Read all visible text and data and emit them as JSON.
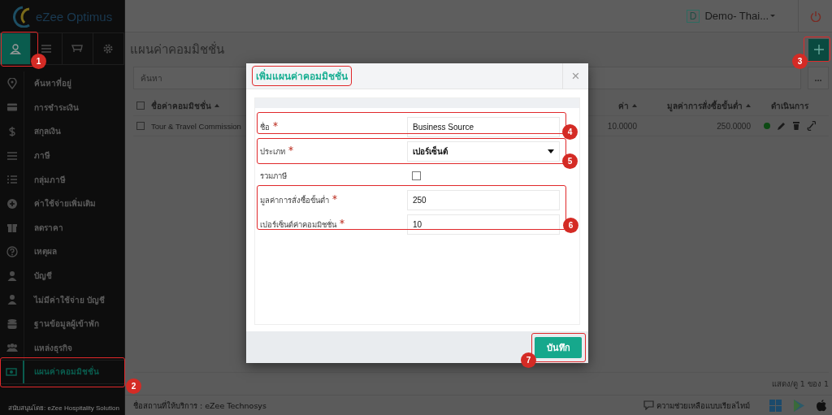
{
  "sidebar": {
    "logo": "eZee Optimus",
    "tabs": [
      {
        "selected": true
      },
      {
        "selected": false
      },
      {
        "selected": false
      },
      {
        "selected": false
      }
    ],
    "items": [
      {
        "label": "ค้นหาที่อยู่",
        "selected": false
      },
      {
        "label": "การชำระเงิน",
        "selected": false
      },
      {
        "label": "สกุลเงิน",
        "selected": false
      },
      {
        "label": "ภาษี",
        "selected": false
      },
      {
        "label": "กลุ่มภาษี",
        "selected": false
      },
      {
        "label": "ค่าใช้จ่ายเพิ่มเติม",
        "selected": false
      },
      {
        "label": "ลดราคา",
        "selected": false
      },
      {
        "label": "เหตุผล",
        "selected": false
      },
      {
        "label": "บัญชี",
        "selected": false
      },
      {
        "label": "ไม่มีค่าใช้จ่าย บัญชี",
        "selected": false
      },
      {
        "label": "ฐานข้อมูลผู้เข้าพัก",
        "selected": false
      },
      {
        "label": "แหล่งธุรกิจ",
        "selected": false
      },
      {
        "label": "แผนค่าคอมมิชชั่น",
        "selected": true
      }
    ],
    "footer": "สนับสนุนโดย: eZee Hospitality Solution"
  },
  "topbar": {
    "property_badge": "D",
    "property": "Demo- Thai..."
  },
  "page": {
    "title": "แผนค่าคอมมิชชั่น",
    "search": {
      "placeholder": "ค้นหา"
    },
    "more": "...",
    "table": {
      "all_checked": false,
      "columns": [
        {
          "label": "ชื่อค่าคอมมิชชั่น"
        },
        {
          "label": "ค่า"
        },
        {
          "label": "มูลค่าการสั่งซื้อขั้นต่ำ"
        },
        {
          "label": "ดำเนินการ"
        }
      ],
      "rows": [
        {
          "checked": false,
          "name": "Tour & Travel Commission",
          "value": "10.0000",
          "min_order": "250.0000"
        }
      ]
    },
    "pager": "แสดง/ดู 1 ของ 1"
  },
  "status_bar": {
    "provider": "ชื่อสถานที่ให้บริการ : eZee Technosys",
    "help": "ความช่วยเหลือแบบเรียลไทม์"
  },
  "modal": {
    "title": "เพิ่มแผนค่าคอมมิชชั่น",
    "title_highlighted": true,
    "close": "×",
    "fields": [
      {
        "kind": "text",
        "label": "ชื่อ",
        "required": true,
        "value": "Business Source"
      },
      {
        "kind": "select",
        "label": "ประเภท",
        "required": true,
        "value": "เปอร์เซ็นต์"
      },
      {
        "kind": "checkbox",
        "label": "รวมภาษี",
        "required": false,
        "checked": false
      },
      {
        "kind": "text",
        "label": "มูลค่าการสั่งซื้อขั้นต่ำ",
        "required": true,
        "value": "250"
      },
      {
        "kind": "text",
        "label": "เปอร์เซ็นต์ค่าคอมมิชชั่น",
        "required": true,
        "value": "10"
      }
    ],
    "save": "บันทึก"
  },
  "callouts": [
    {
      "number": "1"
    },
    {
      "number": "2"
    },
    {
      "number": "3"
    },
    {
      "number": "4"
    },
    {
      "number": "5"
    },
    {
      "number": "6"
    },
    {
      "number": "7"
    }
  ]
}
